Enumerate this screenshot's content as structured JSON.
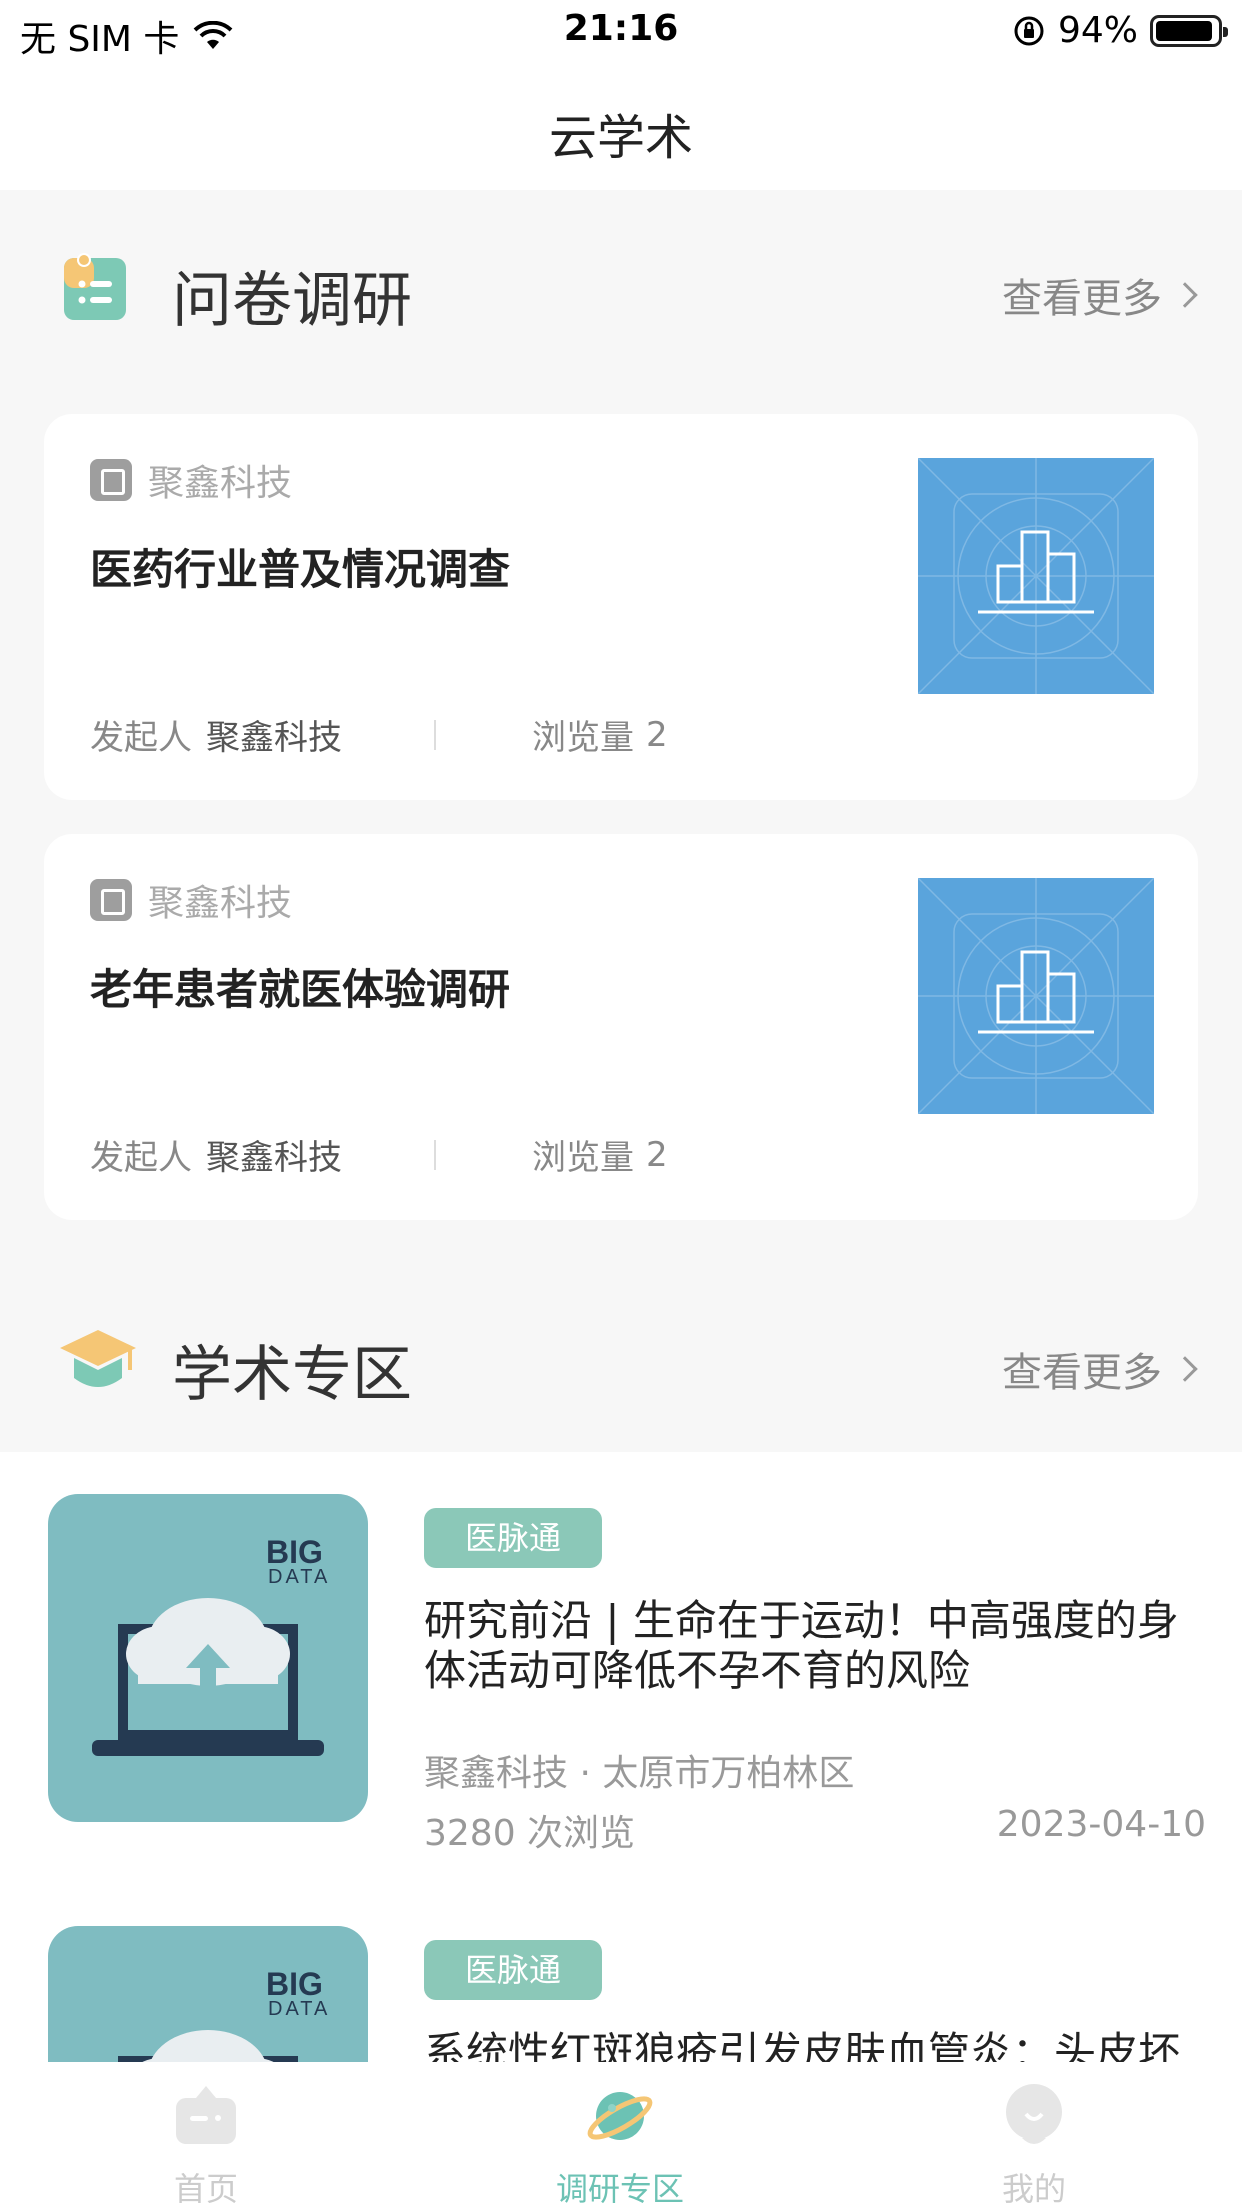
{
  "status_bar": {
    "carrier": "无 SIM 卡",
    "time": "21:16",
    "battery": "94%",
    "battery_level": 0.94
  },
  "nav": {
    "title": "云学术"
  },
  "survey_section": {
    "title": "问卷调研",
    "more": "查看更多",
    "cards": [
      {
        "org": "聚鑫科技",
        "title": "医药行业普及情况调查",
        "initiator_label": "发起人",
        "initiator": "聚鑫科技",
        "views_label": "浏览量",
        "views": "2"
      },
      {
        "org": "聚鑫科技",
        "title": "老年患者就医体验调研",
        "initiator_label": "发起人",
        "initiator": "聚鑫科技",
        "views_label": "浏览量",
        "views": "2"
      }
    ]
  },
  "academic_section": {
    "title": "学术专区",
    "more": "查看更多",
    "articles": [
      {
        "thumb_text_1": "BIG",
        "thumb_text_2": "DATA",
        "tag": "医脉通",
        "title": "研究前沿 | 生命在于运动！中高强度的身体活动可降低不孕不育的风险",
        "source": "聚鑫科技 · 太原市万柏林区",
        "views": "3280 次浏览",
        "date": "2023-04-10"
      },
      {
        "thumb_text_1": "BIG",
        "thumb_text_2": "DATA",
        "tag": "医脉通",
        "title": "系统性红斑狼疮引发皮肤血管炎：头皮坏",
        "source": "",
        "views": "",
        "date": ""
      }
    ]
  },
  "tabbar": {
    "tabs": [
      {
        "label": "首页",
        "icon": "home-icon",
        "active": false
      },
      {
        "label": "调研专区",
        "icon": "planet-icon",
        "active": true
      },
      {
        "label": "我的",
        "icon": "profile-icon",
        "active": false
      }
    ]
  },
  "colors": {
    "accent": "#6cc2b4",
    "tag_bg": "#8bc8b8",
    "survey_thumb": "#5aa4dc",
    "article_thumb": "#7fbcc1",
    "page_bg": "#f7f7f7"
  }
}
